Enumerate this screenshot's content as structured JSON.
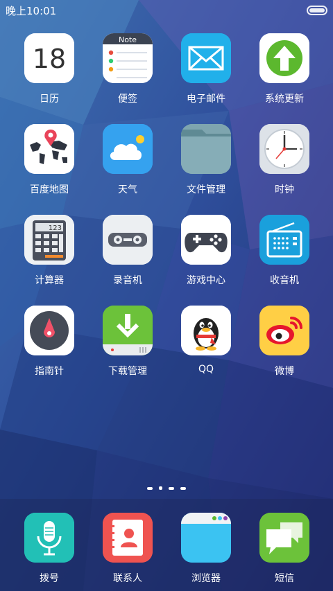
{
  "statusbar": {
    "time": "晚上10:01"
  },
  "pages": {
    "count": 4,
    "current_index": 1
  },
  "apps": [
    {
      "id": "calendar",
      "label": "日历",
      "icon": "calendar-icon",
      "day": "18"
    },
    {
      "id": "notes",
      "label": "便签",
      "icon": "note-icon",
      "header": "Note"
    },
    {
      "id": "email",
      "label": "电子邮件",
      "icon": "mail-icon"
    },
    {
      "id": "update",
      "label": "系统更新",
      "icon": "update-arrow-icon"
    },
    {
      "id": "maps",
      "label": "百度地图",
      "icon": "map-icon"
    },
    {
      "id": "weather",
      "label": "天气",
      "icon": "weather-icon"
    },
    {
      "id": "files",
      "label": "文件管理",
      "icon": "folder-icon"
    },
    {
      "id": "clock",
      "label": "时钟",
      "icon": "clock-icon"
    },
    {
      "id": "calculator",
      "label": "计算器",
      "icon": "calculator-icon",
      "display": "123"
    },
    {
      "id": "recorder",
      "label": "录音机",
      "icon": "tape-recorder-icon"
    },
    {
      "id": "game",
      "label": "游戏中心",
      "icon": "gamepad-icon"
    },
    {
      "id": "radio",
      "label": "收音机",
      "icon": "radio-icon"
    },
    {
      "id": "compass",
      "label": "指南针",
      "icon": "compass-icon"
    },
    {
      "id": "download",
      "label": "下载管理",
      "icon": "download-icon"
    },
    {
      "id": "qq",
      "label": "QQ",
      "icon": "qq-penguin-icon"
    },
    {
      "id": "weibo",
      "label": "微博",
      "icon": "weibo-icon"
    }
  ],
  "dock": [
    {
      "id": "dialer",
      "label": "拨号",
      "icon": "microphone-icon"
    },
    {
      "id": "contacts",
      "label": "联系人",
      "icon": "contacts-icon"
    },
    {
      "id": "browser",
      "label": "浏览器",
      "icon": "browser-icon"
    },
    {
      "id": "sms",
      "label": "短信",
      "icon": "message-bubbles-icon"
    }
  ]
}
